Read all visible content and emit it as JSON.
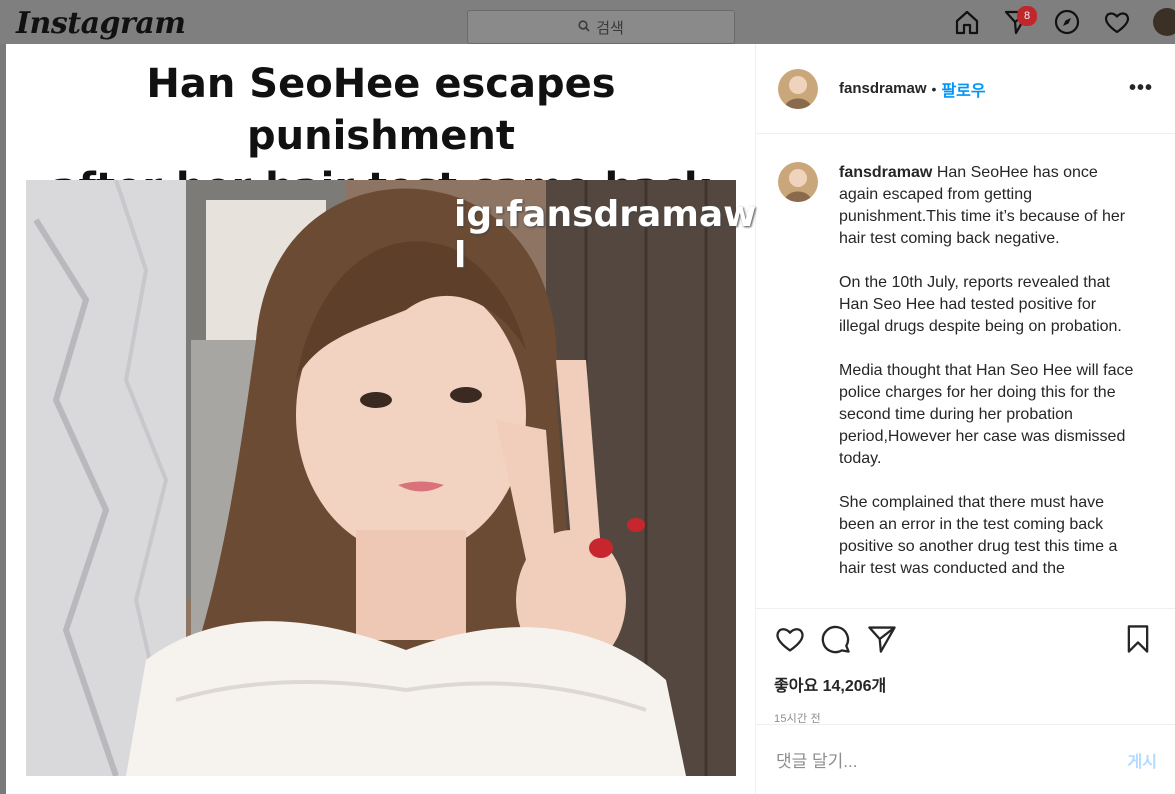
{
  "nav": {
    "logo": "Instagram",
    "search_placeholder": "검색",
    "notification_count": "8"
  },
  "post": {
    "headline_line1": "Han SeoHee escapes punishment",
    "headline_line2": "after her hair test came back negative",
    "watermark": "ig:fansdramaw l",
    "author": "fansdramaw",
    "separator": "•",
    "follow_label": "팔로우",
    "more_label": "•••",
    "caption_paragraphs": [
      "Han SeoHee has once again escaped from getting punishment.This time it’s because of her hair test coming back negative.",
      "On the 10th July, reports revealed that Han Seo Hee had tested positive for illegal drugs despite being on probation.",
      "Media thought that Han Seo Hee will face police charges for her doing this for the second time during her probation period,However her case was dismissed today.",
      "She complained that there must have been an error in the test coming back positive so another drug test this time a hair test was conducted and the"
    ],
    "likes": "좋아요 14,206개",
    "time": "15시간 전",
    "comment_placeholder": "댓글 달기...",
    "post_button": "게시"
  },
  "icons": {
    "home": "home-icon",
    "direct": "direct-icon",
    "explore": "compass-icon",
    "activity": "heart-icon",
    "like": "heart-icon",
    "comment": "comment-icon",
    "share": "share-icon",
    "save": "bookmark-icon"
  }
}
